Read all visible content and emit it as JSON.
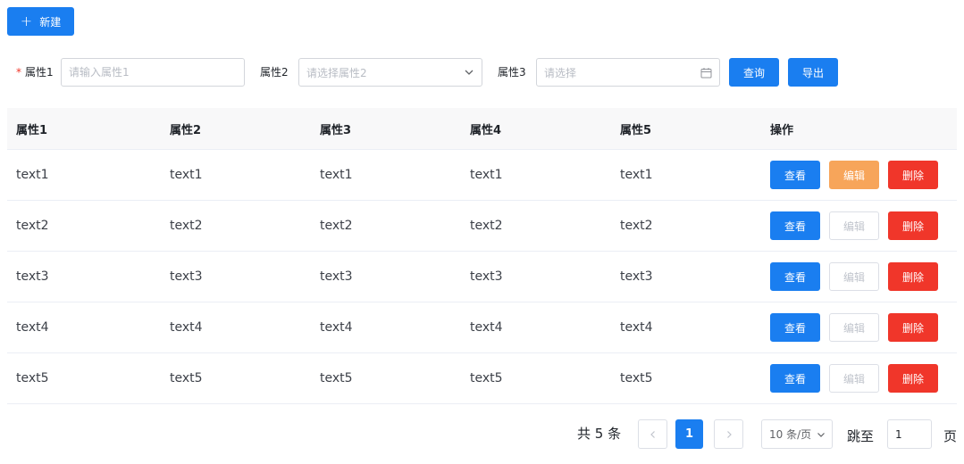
{
  "toolbar": {
    "new_label": "新建",
    "new_icon": "plus-icon"
  },
  "filters": {
    "attr1": {
      "label": "属性1",
      "required_mark": "*",
      "placeholder": "请输入属性1",
      "value": ""
    },
    "attr2": {
      "label": "属性2",
      "placeholder": "请选择属性2",
      "icon": "chevron-down-icon"
    },
    "attr3": {
      "label": "属性3",
      "placeholder": "请选择",
      "icon": "calendar-icon"
    },
    "query_label": "查询",
    "export_label": "导出"
  },
  "table": {
    "headers": [
      "属性1",
      "属性2",
      "属性3",
      "属性4",
      "属性5",
      "操作"
    ],
    "rows": [
      [
        "text1",
        "text1",
        "text1",
        "text1",
        "text1"
      ],
      [
        "text2",
        "text2",
        "text2",
        "text2",
        "text2"
      ],
      [
        "text3",
        "text3",
        "text3",
        "text3",
        "text3"
      ],
      [
        "text4",
        "text4",
        "text4",
        "text4",
        "text4"
      ],
      [
        "text5",
        "text5",
        "text5",
        "text5",
        "text5"
      ]
    ],
    "actions": {
      "view": "查看",
      "edit": "编辑",
      "delete": "删除"
    },
    "edit_enabled_rows": [
      true,
      false,
      false,
      false,
      false
    ]
  },
  "pagination": {
    "total_text": "共 5 条",
    "current_page": "1",
    "page_size": "10 条/页",
    "jump_label": "跳至",
    "jump_value": "1",
    "page_suffix": "页"
  },
  "colors": {
    "primary": "#1a7ef0",
    "warning": "#f7a55a",
    "danger": "#f0362a",
    "disabled_text": "#c0c4cc"
  }
}
